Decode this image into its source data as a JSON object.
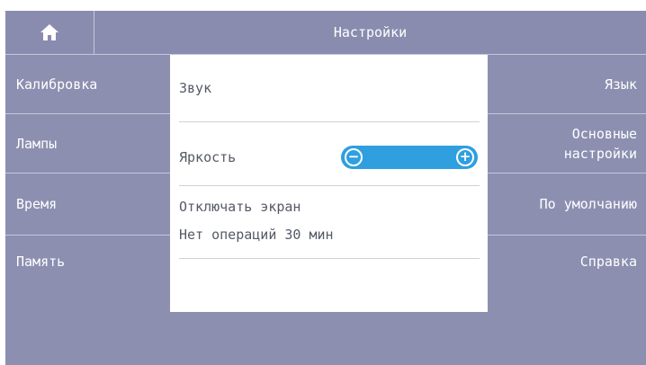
{
  "header": {
    "title": "Настройки",
    "home_icon": "home-icon"
  },
  "left_nav": [
    {
      "label": "Калибровка"
    },
    {
      "label": "Лампы"
    },
    {
      "label": "Время"
    },
    {
      "label": "Память"
    }
  ],
  "right_nav": [
    {
      "label": "Язык"
    },
    {
      "label": "Основные настройки"
    },
    {
      "label": "По умолчанию"
    },
    {
      "label": "Справка"
    }
  ],
  "panel": {
    "sound_label": "Звук",
    "brightness_label": "Яркость",
    "brightness_minus": "−",
    "brightness_plus": "+",
    "screen_off_label": "Отключать экран",
    "screen_off_value": "Нет операций 30 мин"
  },
  "colors": {
    "background": "#8c8fb0",
    "panel": "#ffffff",
    "slider": "#2f9fe0",
    "text_light": "#ffffff",
    "text_dark": "#555a66"
  }
}
